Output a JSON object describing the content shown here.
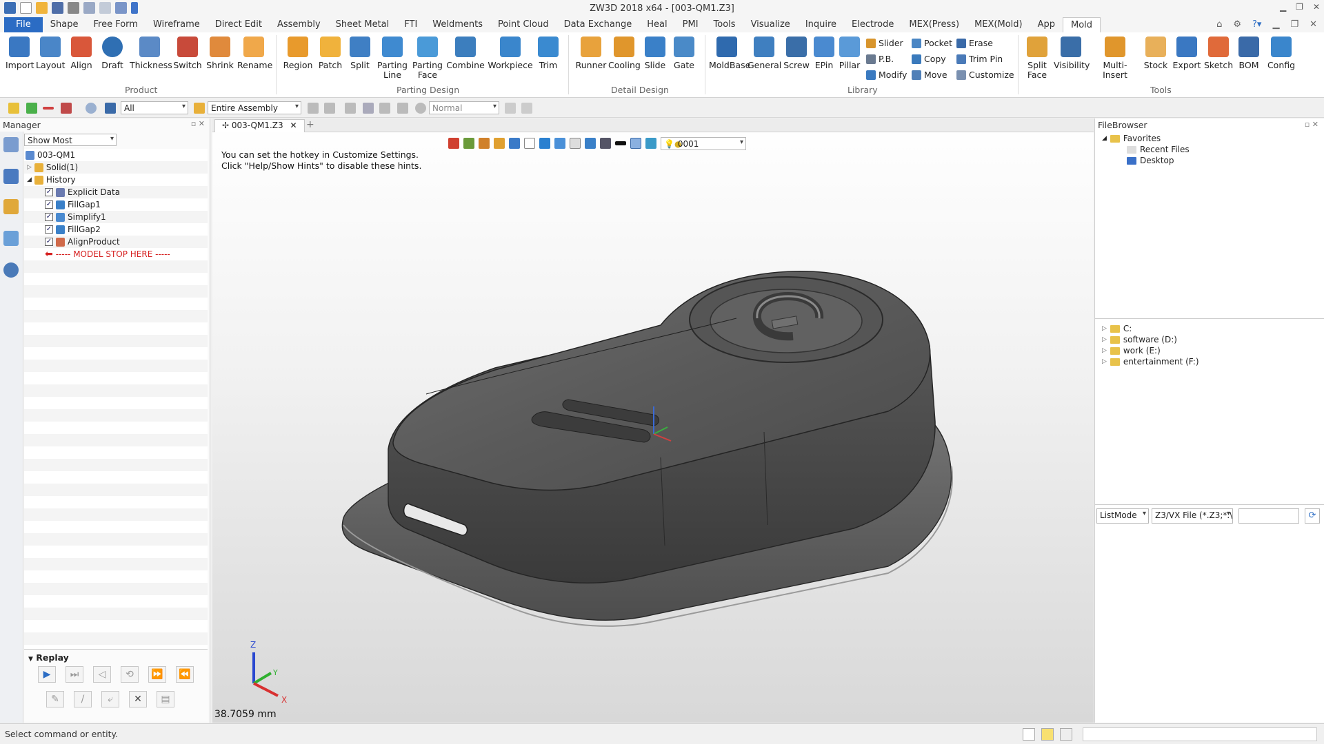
{
  "window": {
    "title": "ZW3D 2018 x64 - [003-QM1.Z3]"
  },
  "menu": [
    "Shape",
    "Free Form",
    "Wireframe",
    "Direct Edit",
    "Assembly",
    "Sheet Metal",
    "FTI",
    "Weldments",
    "Point Cloud",
    "Data Exchange",
    "Heal",
    "PMI",
    "Tools",
    "Visualize",
    "Inquire",
    "Electrode",
    "MEX(Press)",
    "MEX(Mold)",
    "App",
    "Mold"
  ],
  "menu_file": "File",
  "ribbon": {
    "product": {
      "label": "Product",
      "buttons": [
        "Import",
        "Layout",
        "Align",
        "Draft",
        "Thickness",
        "Switch",
        "Shrink",
        "Rename"
      ]
    },
    "parting": {
      "label": "Parting Design",
      "buttons": [
        "Region",
        "Patch",
        "Split",
        "Parting\nLine",
        "Parting\nFace",
        "Combine",
        "Workpiece",
        "Trim"
      ]
    },
    "detail": {
      "label": "Detail Design",
      "buttons": [
        "Runner",
        "Cooling",
        "Slide",
        "Gate"
      ]
    },
    "library": {
      "label": "Library",
      "buttons": [
        "MoldBase",
        "General",
        "Screw",
        "EPin",
        "Pillar"
      ],
      "small": [
        "Slider",
        "P.B.",
        "Modify",
        "Pocket",
        "Copy",
        "Move",
        "Erase",
        "Trim Pin",
        "Customize"
      ]
    },
    "tools": {
      "label": "Tools",
      "buttons": [
        "Split\nFace",
        "Visibility",
        "Multi-Insert",
        "Stock",
        "Export",
        "Sketch",
        "BOM",
        "Config"
      ]
    }
  },
  "toolbar2": {
    "filter": "All",
    "scope": "Entire Assembly",
    "mode": "Normal"
  },
  "manager": {
    "title": "Manager",
    "show_dropdown": "Show Most",
    "tree": [
      {
        "label": "003-QM1"
      },
      {
        "label": "Solid(1)"
      },
      {
        "label": "History"
      },
      {
        "label": "Explicit Data"
      },
      {
        "label": "FillGap1"
      },
      {
        "label": "Simplify1"
      },
      {
        "label": "FillGap2"
      },
      {
        "label": "AlignProduct"
      },
      {
        "label": "----- MODEL STOP HERE -----"
      }
    ],
    "replay_label": "Replay"
  },
  "viewport": {
    "tab": "003-QM1.Z3",
    "hint_line1": "You can set the hotkey in Customize Settings.",
    "hint_line2": "Click \"Help/Show Hints\" to disable these hints.",
    "layer": "0001",
    "measure": "38.7059 mm",
    "axis_x": "X",
    "axis_y": "Y",
    "axis_z": "Z"
  },
  "filebrowser": {
    "title": "FileBrowser",
    "favorites": "Favorites",
    "recent": "Recent Files",
    "desktop": "Desktop",
    "drives": [
      "C:",
      "software (D:)",
      "work (E:)",
      "entertainment (F:)"
    ],
    "listmode": "ListMode",
    "filetype": "Z3/VX File (*.Z3;*.\\"
  },
  "status": "Select command or entity.",
  "colors": {
    "accent": "#2b6cc4",
    "stop_line": "#d62020"
  }
}
